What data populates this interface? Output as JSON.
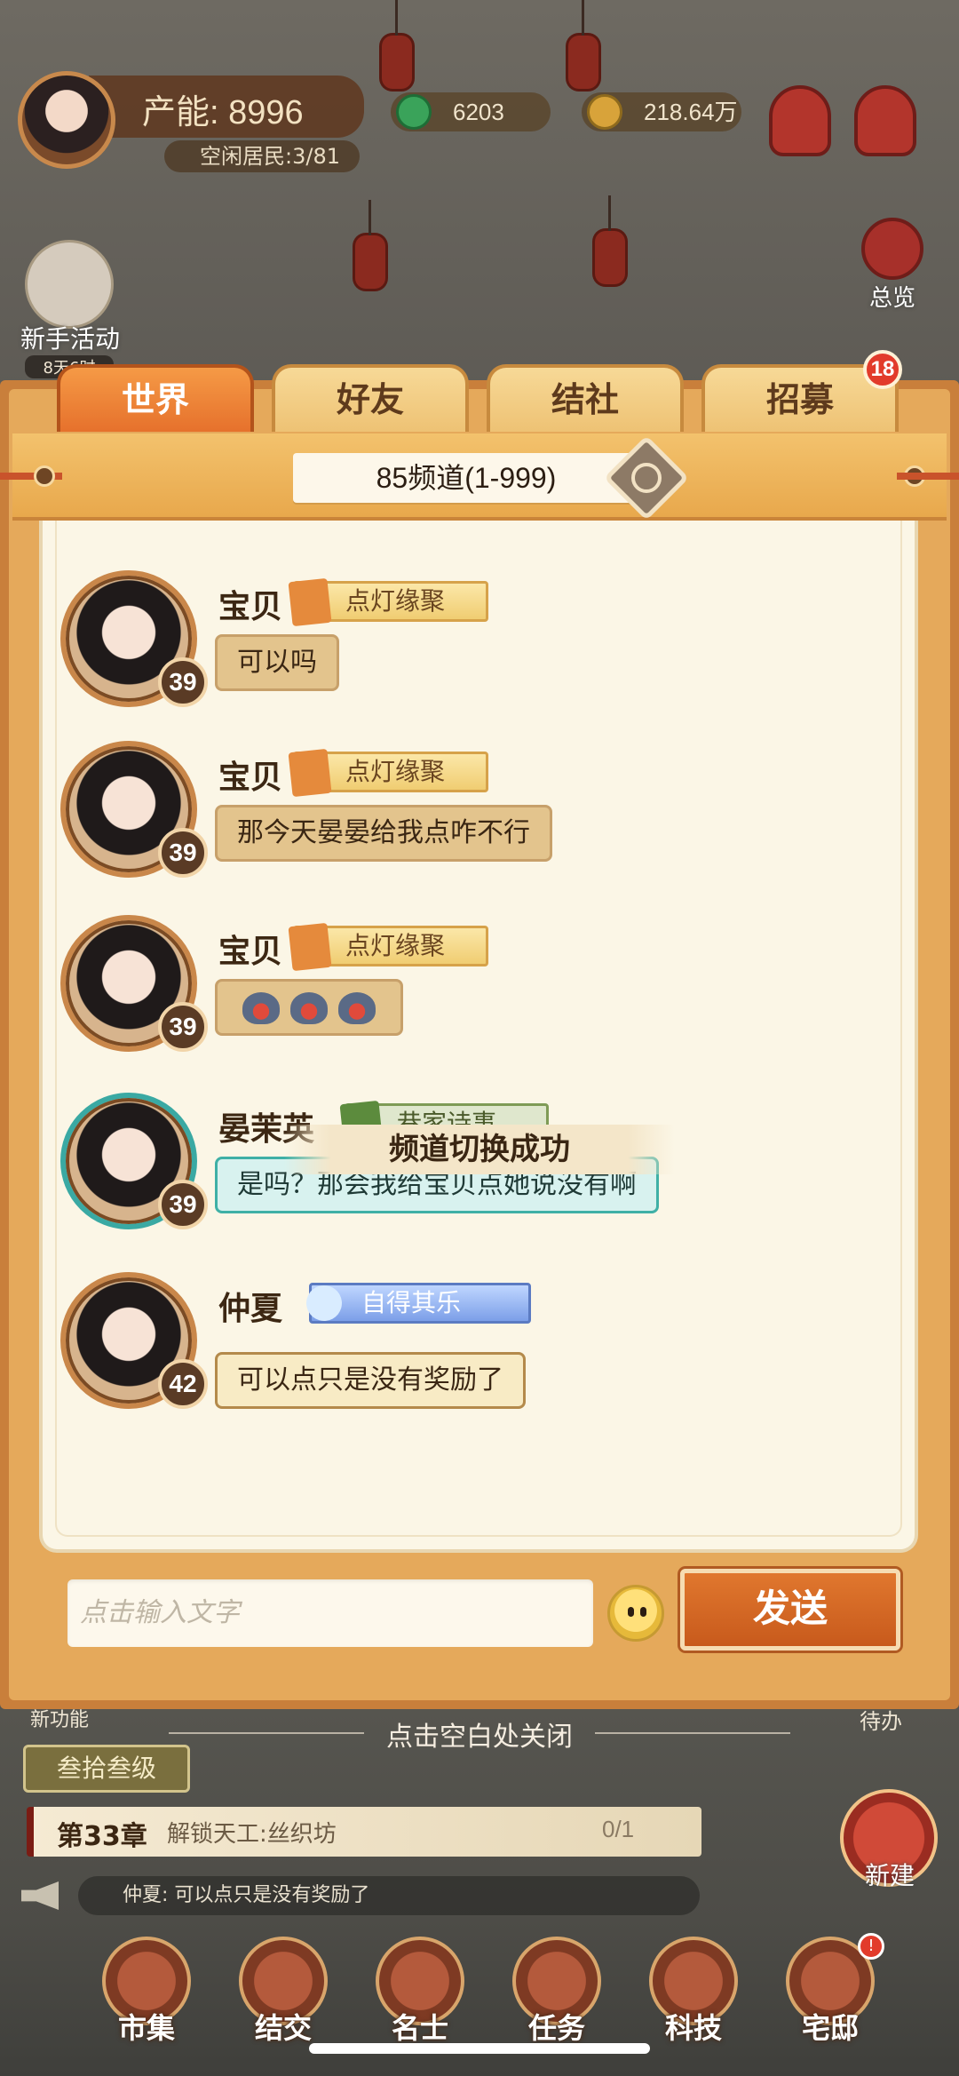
{
  "hud": {
    "capacity_label": "产能: 8996",
    "idle_residents": "空闲居民:3/81",
    "jade": "6203",
    "gold": "218.64万",
    "newbie_event": "新手活动",
    "newbie_timer": "8天6时",
    "overview": "总览"
  },
  "tabs": [
    {
      "label": "世界",
      "active": true
    },
    {
      "label": "好友",
      "active": false
    },
    {
      "label": "结社",
      "active": false
    },
    {
      "label": "招募",
      "active": false,
      "badge": "18"
    }
  ],
  "channel": {
    "label": "85频道(1-999)"
  },
  "messages": [
    {
      "name": "宝贝",
      "title": "点灯缘聚",
      "level": "39",
      "text": "可以吗"
    },
    {
      "name": "宝贝",
      "title": "点灯缘聚",
      "level": "39",
      "text": "那今天晏晏给我点咋不行"
    },
    {
      "name": "宝贝",
      "title": "点灯缘聚",
      "level": "39",
      "text": ""
    },
    {
      "name": "晏茉英",
      "title": "巷家诗事",
      "level": "39",
      "text": "是吗？那会我给宝贝点她说没有啊",
      "avatar_badge": "TapTap",
      "bubble_badge": "TapTap"
    },
    {
      "name": "仲夏",
      "title": "自得其乐",
      "level": "42",
      "text": "可以点只是没有奖励了"
    }
  ],
  "toast": "频道切换成功",
  "input": {
    "placeholder": "点击输入文字",
    "value": ""
  },
  "send_label": "发送",
  "bottom": {
    "new_function": "新功能",
    "pending": "待办",
    "close_hint": "点击空白处关闭",
    "chapter_tag": "叁拾叁级",
    "quest_chapter": "第33章",
    "quest_task": "解锁天工:丝织坊",
    "quest_progress": "0/1",
    "build": "新建",
    "broadcast": "仲夏: 可以点只是没有奖励了"
  },
  "nav": [
    {
      "label": "市集"
    },
    {
      "label": "结交"
    },
    {
      "label": "名士"
    },
    {
      "label": "任务"
    },
    {
      "label": "科技"
    },
    {
      "label": "宅邸",
      "badge": "!"
    }
  ],
  "colors": {
    "accent_orange": "#e6712c",
    "tab_gold": "#eec274",
    "panel_cream": "#fbf6e6",
    "send_orange": "#c85a1c"
  }
}
